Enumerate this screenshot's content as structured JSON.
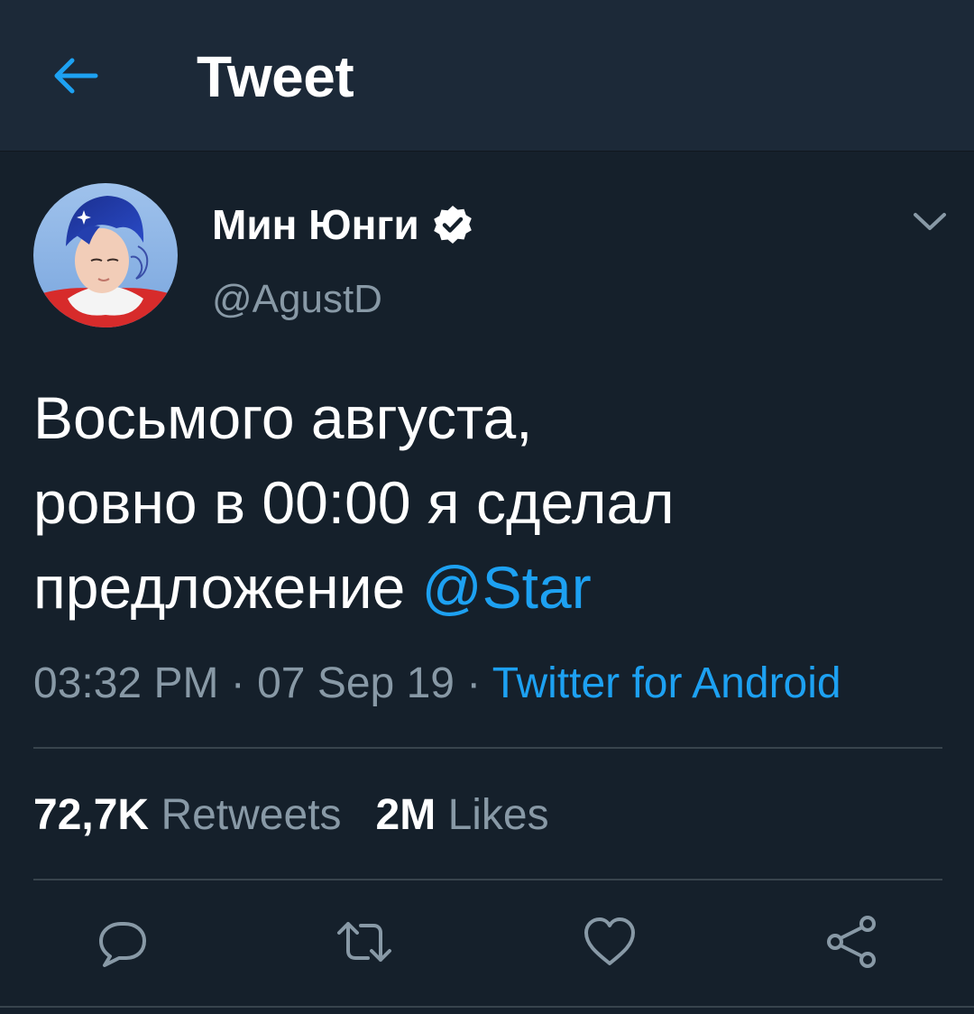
{
  "header": {
    "title": "Tweet",
    "back_icon": "arrow-left-icon"
  },
  "tweet": {
    "author": {
      "name": "Мин Юнги",
      "handle": "@AgustD",
      "verified": true,
      "verified_icon": "verified-badge-icon"
    },
    "menu_icon": "chevron-down-icon",
    "text": {
      "line1": "Восьмого августа,",
      "line2": "ровно в 00:00 я сделал",
      "line3_text": "предложение ",
      "line3_mention": "@Star"
    },
    "meta": {
      "time": "03:32 PM",
      "separator1": " · ",
      "date": "07 Sep 19",
      "separator2": " · ",
      "source": "Twitter for Android"
    },
    "stats": {
      "retweets_count": "72,7K",
      "retweets_label": "Retweets",
      "likes_count": "2M",
      "likes_label": "Likes"
    },
    "actions": {
      "reply_icon": "reply-icon",
      "retweet_icon": "retweet-icon",
      "like_icon": "heart-icon",
      "share_icon": "share-icon"
    }
  },
  "colors": {
    "background": "#15202b",
    "header_background": "#1c2938",
    "accent": "#1da1f2",
    "secondary_text": "#8899a6",
    "divider": "#38444d"
  }
}
